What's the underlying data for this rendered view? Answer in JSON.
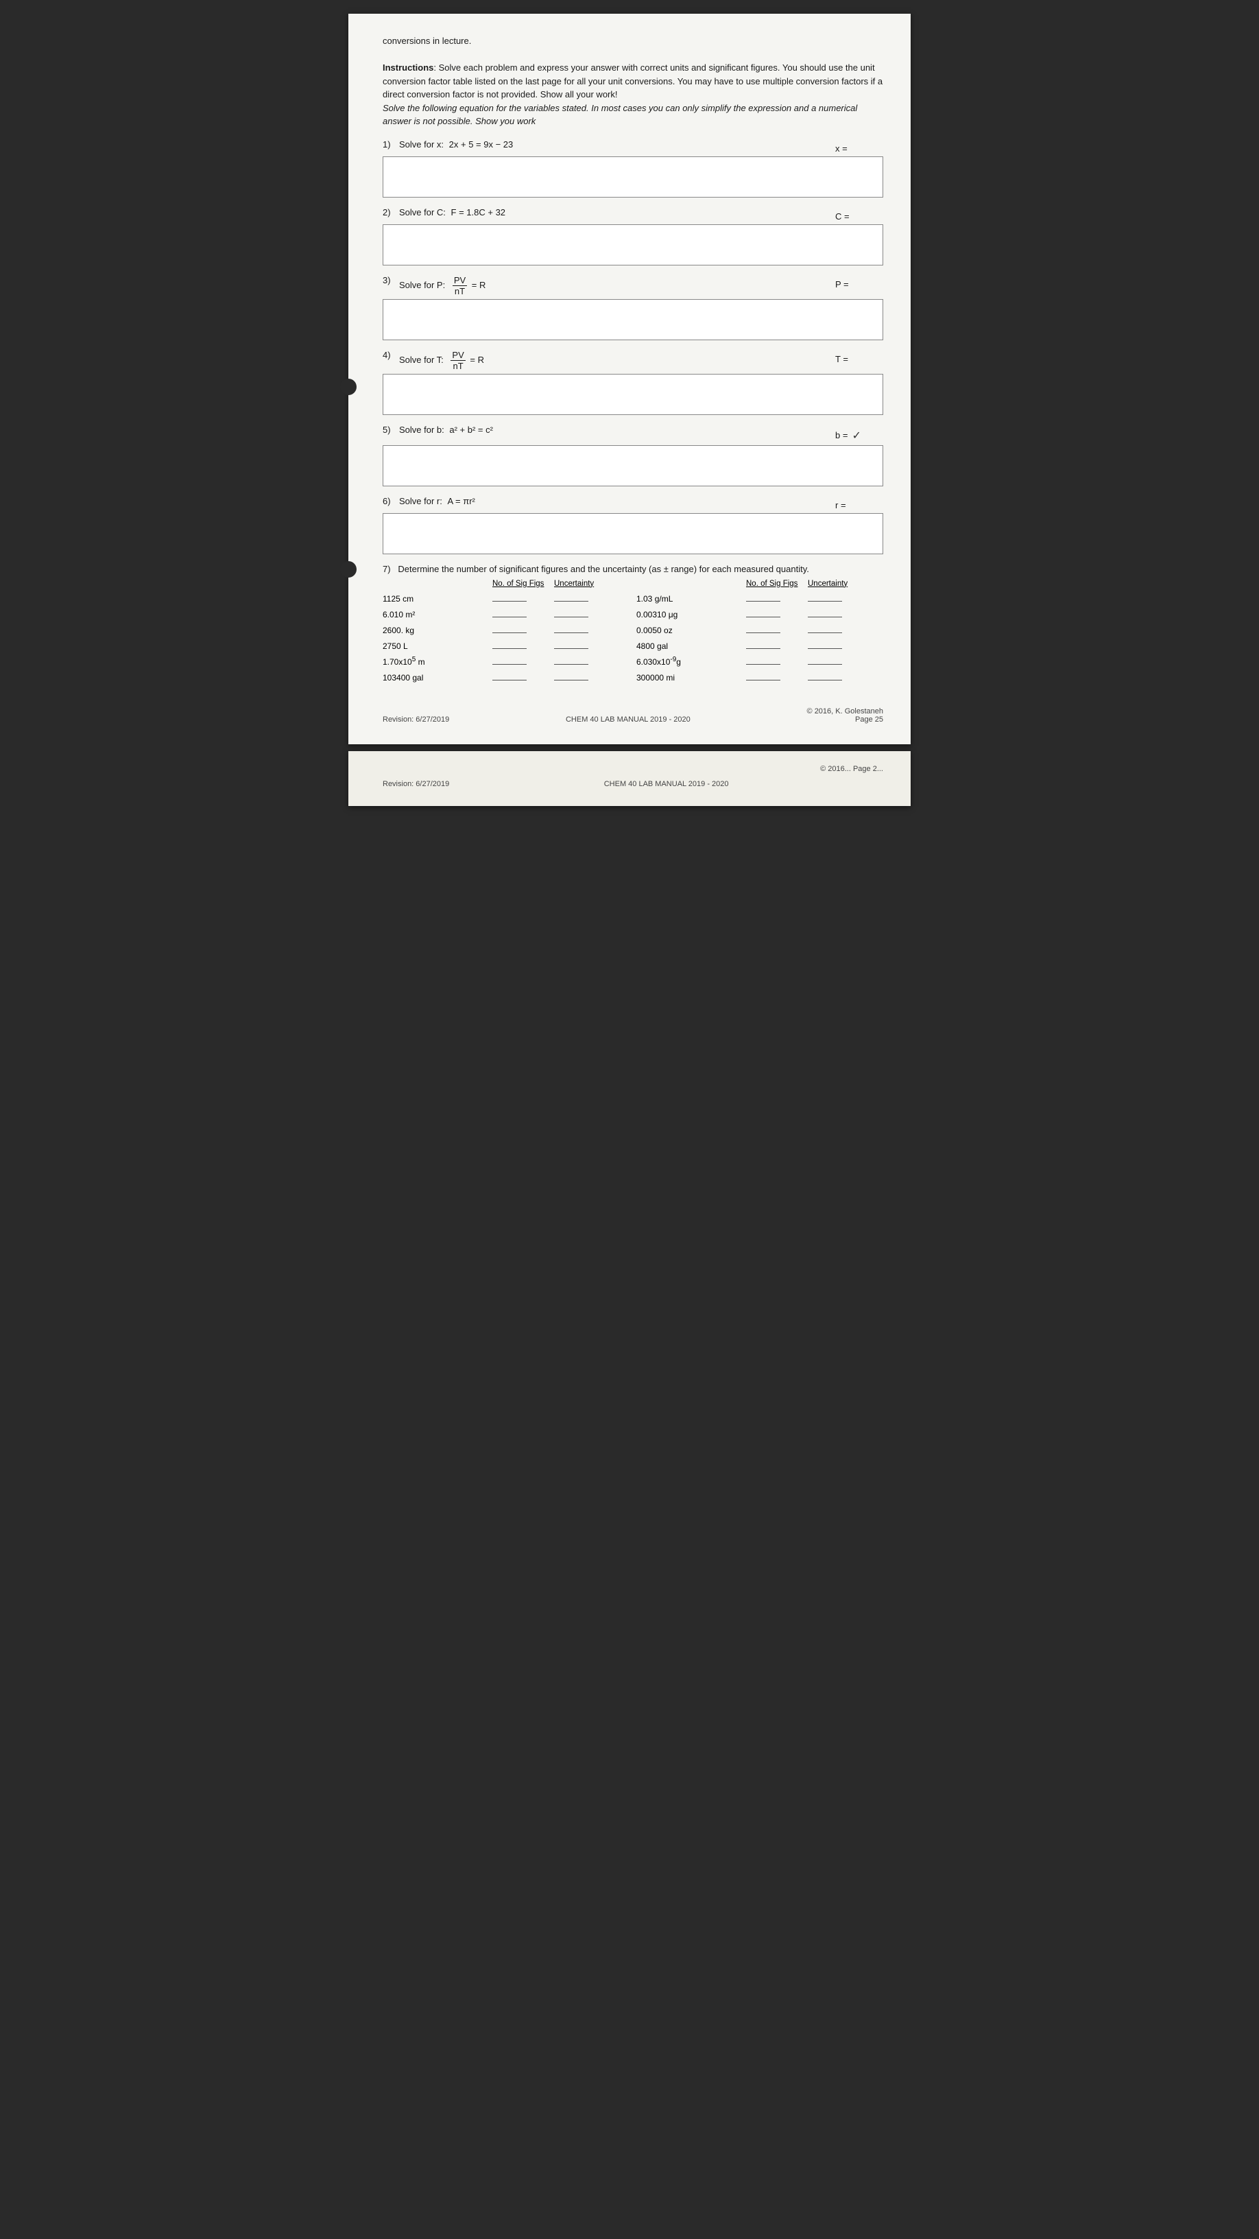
{
  "page": {
    "header_top": "conversions in lecture.",
    "instructions_bold": "Instructions",
    "instructions_text": ": Solve each problem and express your answer with correct units and significant figures. You should use the unit conversion factor table listed on the last page for all your unit conversions. You may have to use multiple conversion factors if a direct conversion factor is not provided. Show all your work!",
    "instructions_italic": "Solve the following equation for the variables stated. In most cases you can only simplify the expression and a numerical answer is not possible. Show you work",
    "problems": [
      {
        "number": "1)",
        "label": "Solve for x:",
        "equation": "2x + 5 = 9x − 23",
        "answer_label": "x ="
      },
      {
        "number": "2)",
        "label": "Solve for C:",
        "equation": "F = 1.8C + 32",
        "answer_label": "C ="
      },
      {
        "number": "3)",
        "label": "Solve for P:",
        "equation_type": "fraction",
        "numerator": "PV",
        "denominator": "nT",
        "eq_suffix": "= R",
        "answer_label": "P ="
      },
      {
        "number": "4)",
        "label": "Solve for T:",
        "equation_type": "fraction",
        "numerator": "PV",
        "denominator": "nT",
        "eq_suffix": "= R",
        "answer_label": "T ="
      },
      {
        "number": "5)",
        "label": "Solve for b:",
        "equation": "a² + b² = c²",
        "answer_label": "b =",
        "has_checkmark": true
      },
      {
        "number": "6)",
        "label": "Solve for r:",
        "equation": "A = πr²",
        "answer_label": "r ="
      }
    ],
    "section7": {
      "number": "7)",
      "title": "Determine the number of significant figures and the uncertainty (as ± range) for each measured quantity.",
      "col_header_sig": "No. of Sig Figs",
      "col_header_unc": "Uncertainty",
      "left_items": [
        "1125 cm",
        "6.010  m²",
        "2600. kg",
        "2750 L",
        "1.70x10⁵ m",
        "103400 gal"
      ],
      "right_items": [
        "1.03 g/mL",
        "0.00310 μg",
        "0.0050 oz",
        "4800 gal",
        "6.030x10⁻⁹g",
        "300000 mi"
      ]
    },
    "footer": {
      "revision": "Revision: 6/27/2019",
      "center": "CHEM 40 LAB MANUAL 2019 - 2020",
      "copyright": "© 2016, K. Golestaneh",
      "page": "Page 25"
    },
    "page2_footer": {
      "revision": "Revision: 6/27/2019",
      "center": "CHEM 40 LAB MANUAL 2019 - 2020",
      "copyright": "© 2016...",
      "page": "Page 2..."
    }
  }
}
